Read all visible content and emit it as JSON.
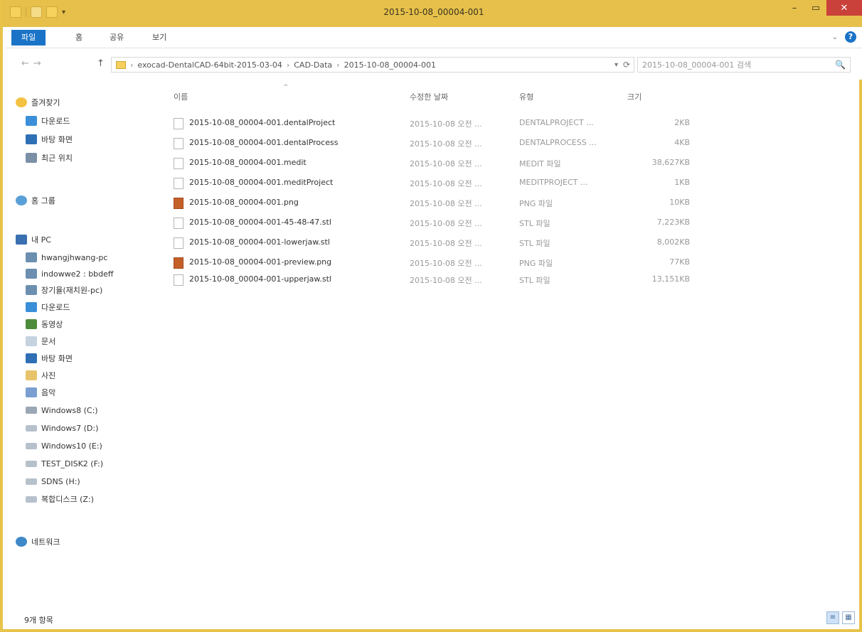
{
  "window": {
    "title": "2015-10-08_00004-001",
    "minimize_glyph": "–",
    "maximize_glyph": "▭",
    "close_glyph": "✕",
    "frame_color": "#e6c04a",
    "accent_color": "#1a73c7",
    "close_color": "#c9413a"
  },
  "quick_access": {
    "dropdown_glyph": "▾"
  },
  "ribbon": {
    "tabs": [
      "파일",
      "홈",
      "공유",
      "보기"
    ],
    "expand_glyph": "⌄",
    "help_label": "?"
  },
  "address": {
    "back_glyph": "←",
    "forward_glyph": "→",
    "up_glyph": "↑",
    "path": [
      "exocad-DentalCAD-64bit-2015-03-04",
      "CAD-Data",
      "2015-10-08_00004-001"
    ],
    "separator": "›",
    "dropdown_glyph": "▾",
    "refresh_glyph": "⟳",
    "search_placeholder": "2015-10-08_00004-001 검색",
    "search_icon": "🔍"
  },
  "nav_pane": {
    "items": [
      {
        "label": "즐겨찾기",
        "icon": "star-icon"
      },
      {
        "label": "다운로드",
        "icon": "download-icon"
      },
      {
        "label": "바탕 화면",
        "icon": "desktop-icon"
      },
      {
        "label": "최근 위치",
        "icon": "recent-icon"
      },
      {
        "label": "홈 그룹",
        "icon": "homegroup-icon"
      },
      {
        "label": "내 PC",
        "icon": "pc-icon"
      },
      {
        "label": "hwangjhwang-pc",
        "icon": "user-pc-icon"
      },
      {
        "label": "indowwe2 : bbdeff",
        "icon": "user-pc-icon"
      },
      {
        "label": "장기율(재치원-pc)",
        "icon": "user-pc-icon"
      },
      {
        "label": "다운로드",
        "icon": "download-icon"
      },
      {
        "label": "동영상",
        "icon": "video-icon"
      },
      {
        "label": "문서",
        "icon": "document-icon"
      },
      {
        "label": "바탕 화면",
        "icon": "desktop-icon"
      },
      {
        "label": "사진",
        "icon": "picture-icon"
      },
      {
        "label": "음악",
        "icon": "music-icon"
      },
      {
        "label": "Windows8 (C:)",
        "icon": "drive-icon"
      },
      {
        "label": "Windows7 (D:)",
        "icon": "drive-icon"
      },
      {
        "label": "Windows10 (E:)",
        "icon": "drive-icon"
      },
      {
        "label": "TEST_DISK2 (F:)",
        "icon": "drive-icon"
      },
      {
        "label": "SDNS (H:)",
        "icon": "drive-icon"
      },
      {
        "label": "복합디스크 (Z:)",
        "icon": "drive-icon"
      },
      {
        "label": "네트워크",
        "icon": "network-icon"
      }
    ]
  },
  "file_list": {
    "columns": [
      "이름",
      "수정한 날짜",
      "유형",
      "크기"
    ],
    "sort_glyph": "^",
    "rows": [
      {
        "name": "2015-10-08_00004-001.dentalProject",
        "date": "2015-10-08 오전 ...",
        "type": "DENTALPROJECT ...",
        "size": "2KB",
        "kind": "file"
      },
      {
        "name": "2015-10-08_00004-001.dentalProcess",
        "date": "2015-10-08 오전 ...",
        "type": "DENTALPROCESS ...",
        "size": "4KB",
        "kind": "file"
      },
      {
        "name": "2015-10-08_00004-001.medit",
        "date": "2015-10-08 오전 ...",
        "type": "MEDIT 파일",
        "size": "38,627KB",
        "kind": "file"
      },
      {
        "name": "2015-10-08_00004-001.meditProject",
        "date": "2015-10-08 오전 ...",
        "type": "MEDITPROJECT ...",
        "size": "1KB",
        "kind": "file"
      },
      {
        "name": "2015-10-08_00004-001.png",
        "date": "2015-10-08 오전 ...",
        "type": "PNG 파일",
        "size": "10KB",
        "kind": "png"
      },
      {
        "name": "2015-10-08_00004-001-45-48-47.stl",
        "date": "2015-10-08 오전 ...",
        "type": "STL 파일",
        "size": "7,223KB",
        "kind": "file"
      },
      {
        "name": "2015-10-08_00004-001-lowerjaw.stl",
        "date": "2015-10-08 오전 ...",
        "type": "STL 파일",
        "size": "8,002KB",
        "kind": "file"
      },
      {
        "name": "2015-10-08_00004-001-preview.png",
        "date": "2015-10-08 오전 ...",
        "type": "PNG 파일",
        "size": "77KB",
        "kind": "png"
      },
      {
        "name": "2015-10-08_00004-001-upperjaw.stl",
        "date": "2015-10-08 오전 ...",
        "type": "STL 파일",
        "size": "13,151KB",
        "kind": "file"
      }
    ]
  },
  "status_bar": {
    "item_count": "9개 항목",
    "details_view_glyph": "≡",
    "icons_view_glyph": "▦"
  }
}
